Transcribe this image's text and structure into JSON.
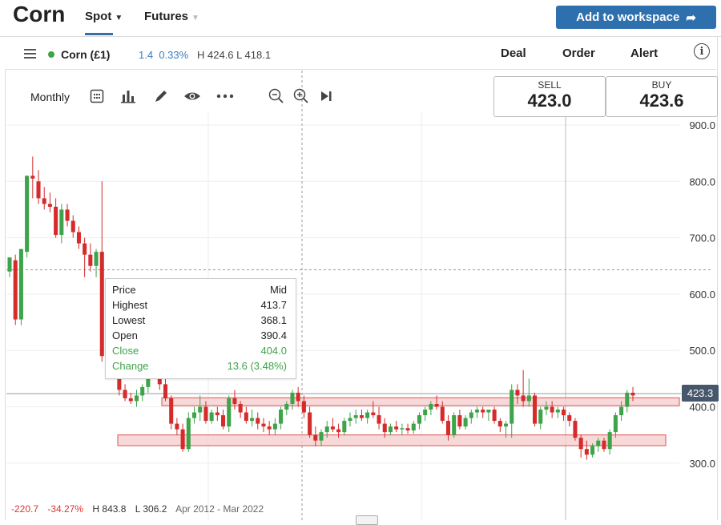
{
  "header": {
    "title": "Corn",
    "tabs": [
      {
        "label": "Spot"
      },
      {
        "label": "Futures"
      }
    ],
    "workspace_button": "Add to workspace"
  },
  "instrument_bar": {
    "name": "Corn (£1)",
    "change": "1.4",
    "change_pct": "0.33%",
    "high": "H 424.6",
    "low": "L 418.1",
    "actions": [
      "Deal",
      "Order",
      "Alert"
    ],
    "info_symbol": "i"
  },
  "toolbar": {
    "period": "Monthly",
    "icons": [
      "calendar-icon",
      "bar-chart-icon",
      "pencil-icon",
      "eye-icon",
      "more-icon",
      "zoom-out-icon",
      "zoom-in-icon",
      "skip-end-icon"
    ]
  },
  "quotes": {
    "sell_label": "SELL",
    "sell_price": "423.0",
    "buy_label": "BUY",
    "buy_price": "423.6"
  },
  "tooltip": {
    "header_label": "Price",
    "header_value": "Mid",
    "rows": [
      {
        "label": "Highest",
        "value": "413.7"
      },
      {
        "label": "Lowest",
        "value": "368.1"
      },
      {
        "label": "Open",
        "value": "390.4"
      },
      {
        "label": "Close",
        "value": "404.0"
      },
      {
        "label": "Change",
        "value": "13.6 (3.48%)"
      }
    ]
  },
  "footer": {
    "change": "-220.7",
    "change_pct": "-34.27%",
    "high": "H 843.8",
    "low": "L 306.2",
    "range": "Apr 2012 - Mar 2022"
  },
  "current_price_label": "423.3",
  "colors": {
    "up": "#3ea34a",
    "down": "#d52b2b",
    "accent": "#2e6fad",
    "zone_fill": "#f6cfcf",
    "zone_stroke": "#d9534f",
    "price_tag": "#46576b"
  },
  "chart_data": {
    "type": "candlestick",
    "ylim": [
      250,
      920
    ],
    "y_ticks": [
      "900.0",
      "800.0",
      "700.0",
      "600.0",
      "500.0",
      "400.0",
      "300.0"
    ],
    "y_tick_values": [
      900,
      800,
      700,
      600,
      500,
      400,
      300
    ],
    "support_resistance_zones": [
      {
        "low": 402,
        "high": 416
      },
      {
        "low": 331,
        "high": 350
      }
    ],
    "crosshair_price": 643,
    "candles": [
      {
        "o": 640,
        "h": 660,
        "l": 630,
        "c": 665
      },
      {
        "o": 660,
        "h": 670,
        "l": 545,
        "c": 555
      },
      {
        "o": 555,
        "h": 570,
        "l": 545,
        "c": 680
      },
      {
        "o": 675,
        "h": 810,
        "l": 665,
        "c": 810
      },
      {
        "o": 810,
        "h": 844,
        "l": 770,
        "c": 805
      },
      {
        "o": 800,
        "h": 820,
        "l": 760,
        "c": 770
      },
      {
        "o": 770,
        "h": 790,
        "l": 750,
        "c": 760
      },
      {
        "o": 760,
        "h": 780,
        "l": 745,
        "c": 755
      },
      {
        "o": 755,
        "h": 770,
        "l": 700,
        "c": 705
      },
      {
        "o": 705,
        "h": 760,
        "l": 690,
        "c": 750
      },
      {
        "o": 750,
        "h": 760,
        "l": 720,
        "c": 730
      },
      {
        "o": 730,
        "h": 740,
        "l": 700,
        "c": 710
      },
      {
        "o": 710,
        "h": 720,
        "l": 680,
        "c": 690
      },
      {
        "o": 690,
        "h": 700,
        "l": 630,
        "c": 670
      },
      {
        "o": 670,
        "h": 690,
        "l": 640,
        "c": 650
      },
      {
        "o": 650,
        "h": 680,
        "l": 630,
        "c": 675
      },
      {
        "o": 675,
        "h": 800,
        "l": 480,
        "c": 490
      },
      {
        "o": 490,
        "h": 510,
        "l": 470,
        "c": 500
      },
      {
        "o": 580,
        "h": 590,
        "l": 470,
        "c": 490
      },
      {
        "o": 490,
        "h": 500,
        "l": 420,
        "c": 430
      },
      {
        "o": 430,
        "h": 440,
        "l": 410,
        "c": 415
      },
      {
        "o": 415,
        "h": 425,
        "l": 405,
        "c": 410
      },
      {
        "o": 410,
        "h": 430,
        "l": 400,
        "c": 420
      },
      {
        "o": 420,
        "h": 440,
        "l": 410,
        "c": 435
      },
      {
        "o": 435,
        "h": 480,
        "l": 425,
        "c": 470
      },
      {
        "o": 470,
        "h": 490,
        "l": 455,
        "c": 465
      },
      {
        "o": 465,
        "h": 475,
        "l": 430,
        "c": 440
      },
      {
        "o": 440,
        "h": 450,
        "l": 410,
        "c": 415
      },
      {
        "o": 415,
        "h": 420,
        "l": 360,
        "c": 370
      },
      {
        "o": 370,
        "h": 380,
        "l": 350,
        "c": 360
      },
      {
        "o": 360,
        "h": 370,
        "l": 320,
        "c": 325
      },
      {
        "o": 325,
        "h": 390,
        "l": 320,
        "c": 380
      },
      {
        "o": 380,
        "h": 400,
        "l": 370,
        "c": 390
      },
      {
        "o": 390,
        "h": 420,
        "l": 375,
        "c": 400
      },
      {
        "o": 400,
        "h": 410,
        "l": 370,
        "c": 375
      },
      {
        "o": 375,
        "h": 395,
        "l": 370,
        "c": 390
      },
      {
        "o": 390,
        "h": 400,
        "l": 375,
        "c": 385
      },
      {
        "o": 385,
        "h": 395,
        "l": 360,
        "c": 365
      },
      {
        "o": 365,
        "h": 420,
        "l": 355,
        "c": 415
      },
      {
        "o": 415,
        "h": 430,
        "l": 395,
        "c": 405
      },
      {
        "o": 405,
        "h": 410,
        "l": 380,
        "c": 390
      },
      {
        "o": 390,
        "h": 400,
        "l": 370,
        "c": 375
      },
      {
        "o": 375,
        "h": 395,
        "l": 365,
        "c": 380
      },
      {
        "o": 380,
        "h": 390,
        "l": 360,
        "c": 370
      },
      {
        "o": 370,
        "h": 380,
        "l": 355,
        "c": 365
      },
      {
        "o": 365,
        "h": 375,
        "l": 350,
        "c": 360
      },
      {
        "o": 360,
        "h": 380,
        "l": 350,
        "c": 370
      },
      {
        "o": 370,
        "h": 400,
        "l": 360,
        "c": 395
      },
      {
        "o": 395,
        "h": 410,
        "l": 385,
        "c": 405
      },
      {
        "o": 405,
        "h": 430,
        "l": 395,
        "c": 425
      },
      {
        "o": 425,
        "h": 435,
        "l": 400,
        "c": 410
      },
      {
        "o": 410,
        "h": 420,
        "l": 380,
        "c": 390
      },
      {
        "o": 390,
        "h": 400,
        "l": 345,
        "c": 350
      },
      {
        "o": 350,
        "h": 365,
        "l": 330,
        "c": 340
      },
      {
        "o": 340,
        "h": 360,
        "l": 330,
        "c": 355
      },
      {
        "o": 355,
        "h": 375,
        "l": 345,
        "c": 365
      },
      {
        "o": 365,
        "h": 380,
        "l": 355,
        "c": 360
      },
      {
        "o": 360,
        "h": 370,
        "l": 345,
        "c": 355
      },
      {
        "o": 355,
        "h": 380,
        "l": 350,
        "c": 375
      },
      {
        "o": 375,
        "h": 390,
        "l": 365,
        "c": 380
      },
      {
        "o": 380,
        "h": 395,
        "l": 370,
        "c": 385
      },
      {
        "o": 385,
        "h": 395,
        "l": 375,
        "c": 380
      },
      {
        "o": 380,
        "h": 395,
        "l": 370,
        "c": 390
      },
      {
        "o": 390,
        "h": 410,
        "l": 380,
        "c": 385
      },
      {
        "o": 385,
        "h": 400,
        "l": 360,
        "c": 370
      },
      {
        "o": 370,
        "h": 380,
        "l": 345,
        "c": 355
      },
      {
        "o": 355,
        "h": 370,
        "l": 350,
        "c": 365
      },
      {
        "o": 365,
        "h": 375,
        "l": 355,
        "c": 360
      },
      {
        "o": 360,
        "h": 370,
        "l": 350,
        "c": 362
      },
      {
        "o": 362,
        "h": 370,
        "l": 352,
        "c": 358
      },
      {
        "o": 358,
        "h": 375,
        "l": 352,
        "c": 370
      },
      {
        "o": 370,
        "h": 390,
        "l": 360,
        "c": 385
      },
      {
        "o": 385,
        "h": 400,
        "l": 375,
        "c": 395
      },
      {
        "o": 395,
        "h": 410,
        "l": 385,
        "c": 405
      },
      {
        "o": 405,
        "h": 420,
        "l": 395,
        "c": 400
      },
      {
        "o": 400,
        "h": 410,
        "l": 370,
        "c": 375
      },
      {
        "o": 375,
        "h": 385,
        "l": 340,
        "c": 350
      },
      {
        "o": 350,
        "h": 390,
        "l": 345,
        "c": 385
      },
      {
        "o": 385,
        "h": 395,
        "l": 360,
        "c": 365
      },
      {
        "o": 365,
        "h": 385,
        "l": 360,
        "c": 380
      },
      {
        "o": 380,
        "h": 395,
        "l": 370,
        "c": 390
      },
      {
        "o": 390,
        "h": 400,
        "l": 380,
        "c": 395
      },
      {
        "o": 395,
        "h": 400,
        "l": 380,
        "c": 390
      },
      {
        "o": 390,
        "h": 395,
        "l": 375,
        "c": 395
      },
      {
        "o": 395,
        "h": 400,
        "l": 370,
        "c": 375
      },
      {
        "o": 375,
        "h": 380,
        "l": 355,
        "c": 365
      },
      {
        "o": 365,
        "h": 375,
        "l": 345,
        "c": 370
      },
      {
        "o": 370,
        "h": 440,
        "l": 345,
        "c": 430
      },
      {
        "o": 430,
        "h": 440,
        "l": 405,
        "c": 420
      },
      {
        "o": 420,
        "h": 465,
        "l": 400,
        "c": 410
      },
      {
        "o": 410,
        "h": 450,
        "l": 400,
        "c": 420
      },
      {
        "o": 420,
        "h": 425,
        "l": 365,
        "c": 370
      },
      {
        "o": 370,
        "h": 400,
        "l": 360,
        "c": 395
      },
      {
        "o": 395,
        "h": 410,
        "l": 385,
        "c": 400
      },
      {
        "o": 400,
        "h": 410,
        "l": 380,
        "c": 390
      },
      {
        "o": 390,
        "h": 400,
        "l": 380,
        "c": 395
      },
      {
        "o": 395,
        "h": 400,
        "l": 375,
        "c": 385
      },
      {
        "o": 385,
        "h": 390,
        "l": 365,
        "c": 375
      },
      {
        "o": 375,
        "h": 380,
        "l": 340,
        "c": 345
      },
      {
        "o": 345,
        "h": 350,
        "l": 310,
        "c": 325
      },
      {
        "o": 325,
        "h": 340,
        "l": 306,
        "c": 315
      },
      {
        "o": 315,
        "h": 335,
        "l": 310,
        "c": 330
      },
      {
        "o": 330,
        "h": 345,
        "l": 320,
        "c": 340
      },
      {
        "o": 340,
        "h": 345,
        "l": 320,
        "c": 325
      },
      {
        "o": 325,
        "h": 360,
        "l": 315,
        "c": 355
      },
      {
        "o": 355,
        "h": 390,
        "l": 345,
        "c": 385
      },
      {
        "o": 385,
        "h": 410,
        "l": 375,
        "c": 400
      },
      {
        "o": 400,
        "h": 430,
        "l": 390,
        "c": 425
      },
      {
        "o": 425,
        "h": 435,
        "l": 410,
        "c": 420
      }
    ]
  }
}
